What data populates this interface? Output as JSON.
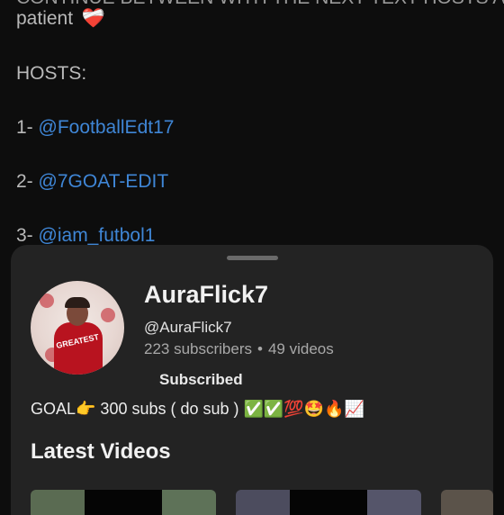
{
  "description": {
    "cutoff_line": "CONTINUE BETWEEN WITH THE NEXT TEXT HOSTS AT",
    "patient_text": "patient",
    "heart_emoji": "❤️‍🩹",
    "hosts_heading": "HOSTS:",
    "hosts": [
      {
        "index": "1-",
        "handle": "@FootballEdt17"
      },
      {
        "index": "2-",
        "handle": "@7GOAT-EDIT"
      },
      {
        "index": "3-",
        "handle": "@iam_futbol1"
      }
    ],
    "link_color": "#3f86d6"
  },
  "channel": {
    "name": "AuraFlick7",
    "handle": "@AuraFlick7",
    "subscribers": "223 subscribers",
    "separator": "•",
    "videos": "49 videos",
    "subscribe_label": "Subscribed",
    "bio": "GOAL👉 300 subs ( do sub ) ✅✅💯🤩🔥📈",
    "avatar_text": "GREATEST"
  },
  "section": {
    "latest_videos": "Latest Videos"
  },
  "colors": {
    "page_bg": "#0d0d0d",
    "sheet_bg": "#232323",
    "avatar_red": "#b8131f"
  }
}
